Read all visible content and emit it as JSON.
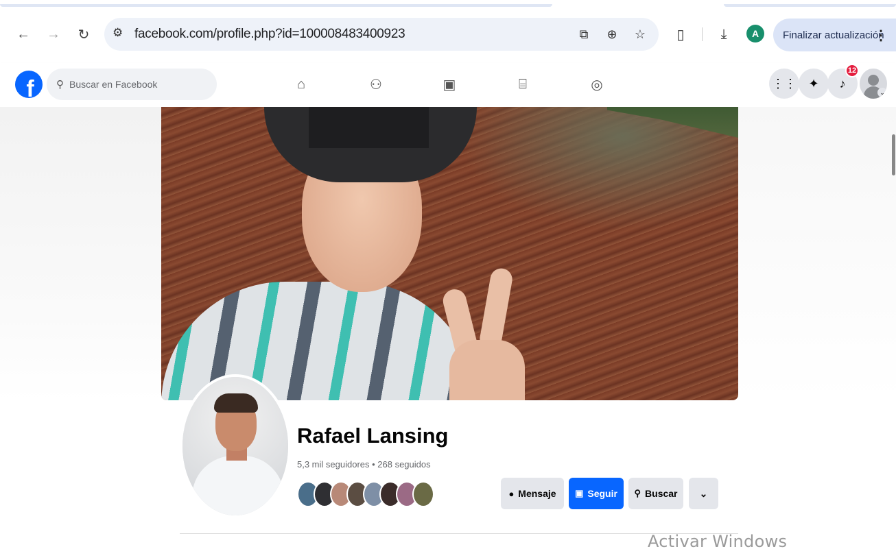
{
  "browser": {
    "url": "facebook.com/profile.php?id=100008483400923",
    "profile_initial": "A",
    "update_button": "Finalizar actualización",
    "icons": [
      "back-icon",
      "forward-icon",
      "reload-icon",
      "site-settings-icon",
      "install-icon",
      "zoom-icon",
      "bookmark-star-icon",
      "extensions-icon",
      "download-icon",
      "menu-dots-icon"
    ]
  },
  "facebook": {
    "logo": "f",
    "search_placeholder": "Buscar en Facebook",
    "notification_count": "12",
    "nav_icons": [
      "home-icon",
      "friends-icon",
      "video-icon",
      "marketplace-icon",
      "gaming-icon"
    ],
    "right_icons": [
      "apps-menu-icon",
      "messenger-icon",
      "notifications-icon",
      "account-icon"
    ],
    "accent_color": "#0866ff"
  },
  "profile": {
    "name": "Rafael Lansing",
    "stats": "5,3 mil seguidores • 268 seguidos",
    "buttons": {
      "message": "Mensaje",
      "follow": "Seguir",
      "search": "Buscar",
      "more": "⌄"
    }
  },
  "watermark": "Activar Windows"
}
